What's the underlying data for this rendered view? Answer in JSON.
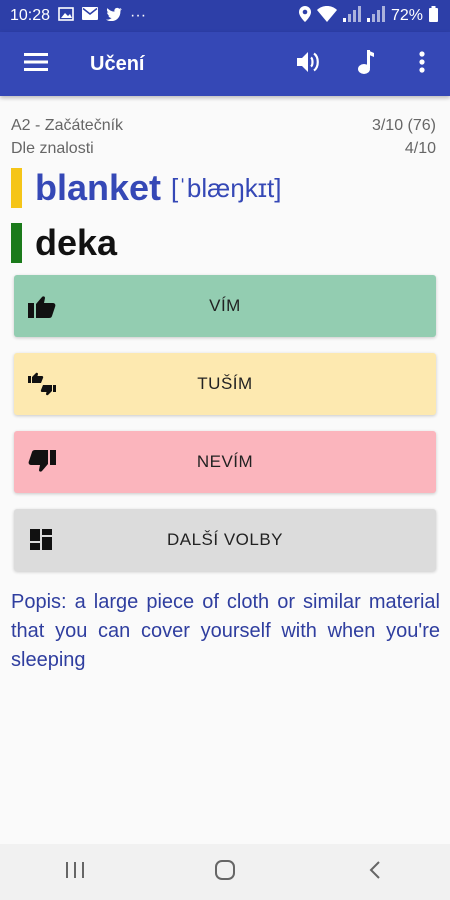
{
  "status": {
    "time": "10:28",
    "more": "···",
    "battery_pct": "72%"
  },
  "appbar": {
    "title": "Učení",
    "icons": [
      "menu-icon",
      "speaker-icon",
      "music-note-icon",
      "more-vert-icon"
    ]
  },
  "meta": {
    "level": "A2 - Začátečník",
    "level_progress": "3/10 (76)",
    "mode": "Dle znalosti",
    "mode_progress": "4/10"
  },
  "word": {
    "text": "blanket",
    "pronunciation": "[ˈblæŋkɪt]",
    "indicator_color": "#f5c518"
  },
  "translation": {
    "text": "deka",
    "indicator_color": "#1a7a1a"
  },
  "buttons": {
    "know": {
      "label": "VÍM",
      "color": "#93cdb1"
    },
    "guess": {
      "label": "TUŠÍM",
      "color": "#fde9b0"
    },
    "dont_know": {
      "label": "NEVÍM",
      "color": "#fbb5bd"
    },
    "more": {
      "label": "DALŠÍ VOLBY",
      "color": "#dcdcdc"
    }
  },
  "description": "Popis: a large piece of cloth or similar material that you can cover yourself with when you're sleeping",
  "colors": {
    "primary": "#3548b6",
    "status_bar": "#2d3fa8"
  }
}
